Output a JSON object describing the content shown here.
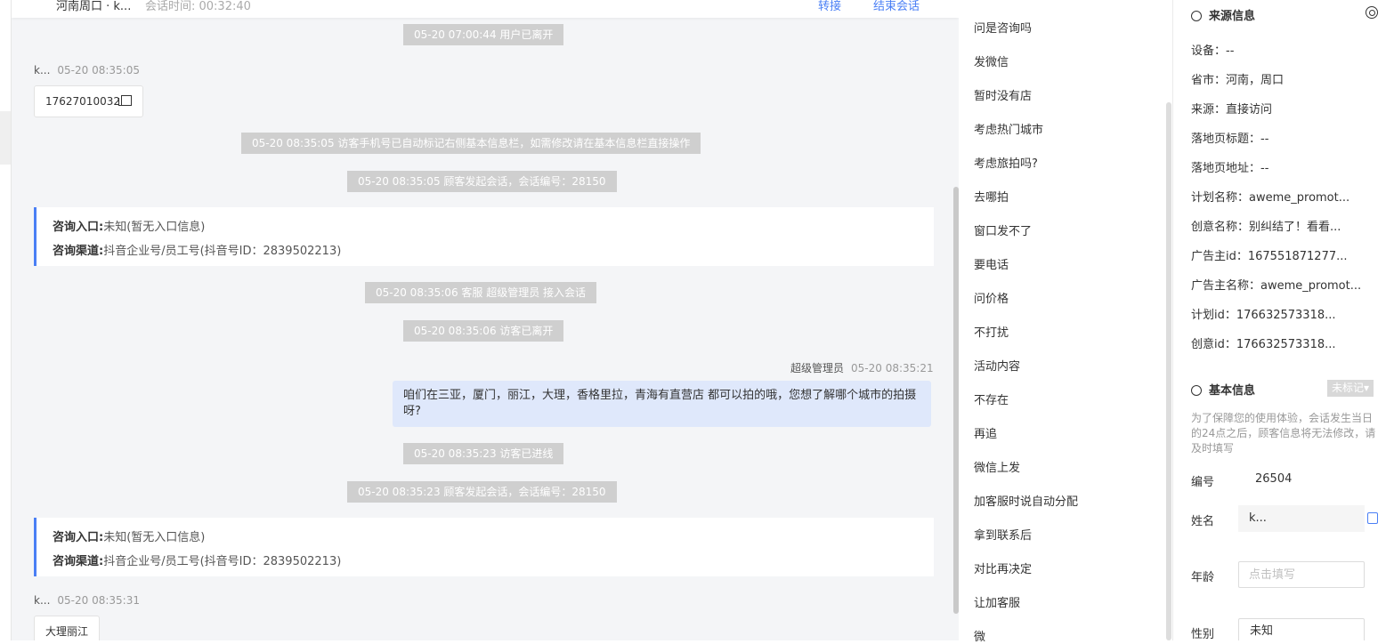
{
  "header": {
    "title": "河南周口 · k...",
    "duration": "会话时间: 00:32:40",
    "transfer": "转接",
    "end": "结束会话"
  },
  "chat": {
    "sys1": "05-20 07:00:44 用户已离开",
    "visitor1": {
      "name": "k...",
      "time": "05-20 08:35:05",
      "text": "17627010032"
    },
    "sys2": "05-20 08:35:05 访客手机号已自动标记右侧基本信息栏，如需修改请在基本信息栏直接操作",
    "sys3": "05-20 08:35:05 顾客发起会话，会话编号：28150",
    "entry1": {
      "lbl1": "咨询入口:",
      "val1": "未知(暂无入口信息)",
      "lbl2": "咨询渠道:",
      "val2": "抖音企业号/员工号(抖音号ID：2839502213)"
    },
    "sys4": "05-20 08:35:06 客服 超级管理员 接入会话",
    "sys5": "05-20 08:35:06 访客已离开",
    "agent": {
      "name": "超级管理员",
      "time": "05-20 08:35:21",
      "text": "咱们在三亚，厦门，丽江，大理，香格里拉，青海有直营店 都可以拍的哦，您想了解哪个城市的拍摄呀?"
    },
    "sys6": "05-20 08:35:23 访客已进线",
    "sys7": "05-20 08:35:23 顾客发起会话，会话编号：28150",
    "entry2": {
      "lbl1": "咨询入口:",
      "val1": "未知(暂无入口信息)",
      "lbl2": "咨询渠道:",
      "val2": "抖音企业号/员工号(抖音号ID：2839502213)"
    },
    "visitor2": {
      "name": "k...",
      "time": "05-20 08:35:31",
      "text": "大理丽江"
    }
  },
  "quick_replies": [
    "问是咨询吗",
    "发微信",
    "暂时没有店",
    "考虑热门城市",
    "考虑旅拍吗?",
    "去哪拍",
    "窗口发不了",
    "要电话",
    "问价格",
    "不打扰",
    "活动内容",
    "不存在",
    "再追",
    "微信上发",
    "加客服时说自动分配",
    "拿到联系后",
    "对比再决定",
    "让加客服",
    "微"
  ],
  "source": {
    "title": "来源信息",
    "items": [
      "设备：--",
      "省市：河南，周口",
      "来源：直接访问",
      "落地页标题：--",
      "落地页地址：--",
      "计划名称：aweme_promot...",
      "创意名称：别纠结了！看看...",
      "广告主id：167551871277...",
      "广告主名称：aweme_promot...",
      "计划id：176632573318...",
      "创意id：176632573318..."
    ]
  },
  "basic": {
    "title": "基本信息",
    "tag": "未标记▾",
    "note": "为了保障您的使用体验，会话发生当日的24点之后，顾客信息将无法修改，请及时填写",
    "id_label": "编号",
    "id_value": "26504",
    "name_label": "姓名",
    "name_value": "k...",
    "age_label": "年龄",
    "age_placeholder": "点击填写",
    "gender_label": "性别",
    "gender_value": "未知"
  }
}
